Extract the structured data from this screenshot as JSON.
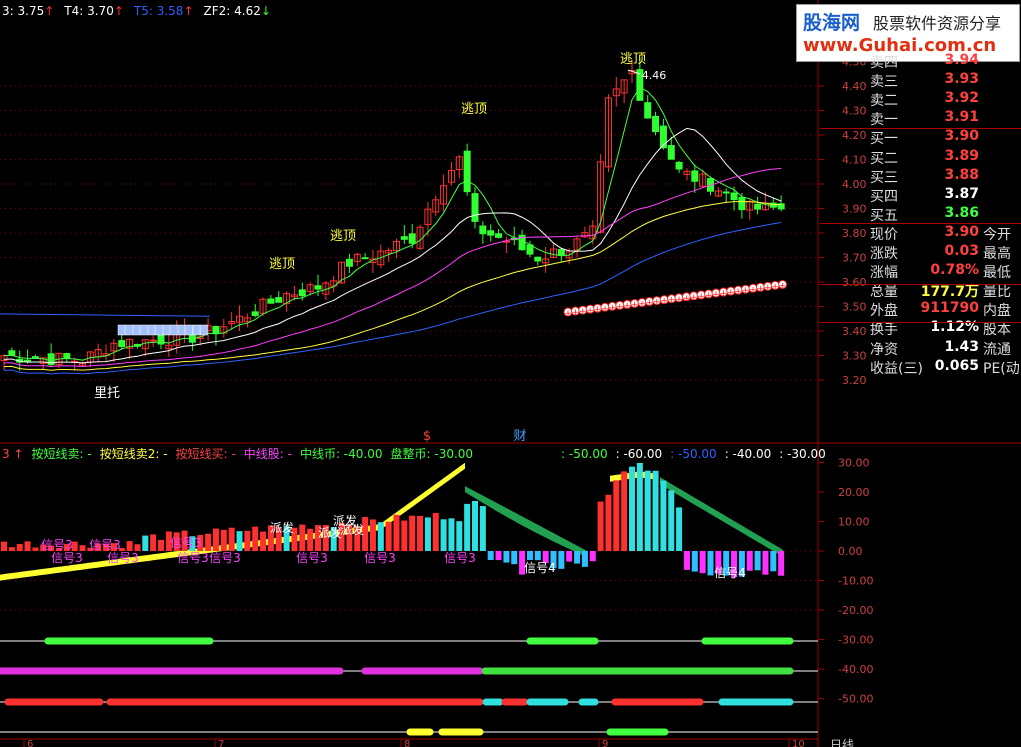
{
  "top_indicators": [
    {
      "text": "3: 3.75",
      "arrow": "↑",
      "color": "#ffffff",
      "arrow_color": "#ff3030"
    },
    {
      "text": "T4: 3.70",
      "arrow": "↑",
      "color": "#ffffff",
      "arrow_color": "#ff3030"
    },
    {
      "text": "T5: 3.58",
      "arrow": "↑",
      "color": "#3060ff",
      "arrow_color": "#ff3030"
    },
    {
      "text": "ZF2: 4.62",
      "arrow": "↓",
      "color": "#ffffff",
      "arrow_color": "#30ff30"
    }
  ],
  "logo": {
    "brand": "股海网",
    "slogan": "股票软件资源分享",
    "url": "www.Guhai.com.cn"
  },
  "quote_rows": [
    {
      "label": "卖四",
      "value": "3.94",
      "color": "#ff4040",
      "right": ""
    },
    {
      "label": "卖三",
      "value": "3.93",
      "color": "#ff4040",
      "right": ""
    },
    {
      "label": "卖二",
      "value": "3.92",
      "color": "#ff4040",
      "right": ""
    },
    {
      "label": "卖一",
      "value": "3.91",
      "color": "#ff4040",
      "right": ""
    },
    {
      "label": "买一",
      "value": "3.90",
      "color": "#ff4040",
      "right": ""
    },
    {
      "label": "买二",
      "value": "3.89",
      "color": "#ff4040",
      "right": ""
    },
    {
      "label": "买三",
      "value": "3.88",
      "color": "#ff4040",
      "right": ""
    },
    {
      "label": "买四",
      "value": "3.87",
      "color": "#ffffff",
      "right": ""
    },
    {
      "label": "买五",
      "value": "3.86",
      "color": "#40ff40",
      "right": ""
    },
    {
      "label": "现价",
      "value": "3.90",
      "color": "#ff4040",
      "right": "今开"
    },
    {
      "label": "涨跌",
      "value": "0.03",
      "color": "#ff4040",
      "right": "最高"
    },
    {
      "label": "涨幅",
      "value": "0.78%",
      "color": "#ff4040",
      "right": "最低"
    },
    {
      "label": "总量",
      "value": "177.7万",
      "color": "#ffff40",
      "right": "量比"
    },
    {
      "label": "外盘",
      "value": "911790",
      "color": "#ff4040",
      "right": "内盘"
    },
    {
      "label": "换手",
      "value": "1.12%",
      "color": "#ffffff",
      "right": "股本"
    },
    {
      "label": "净资",
      "value": "1.43",
      "color": "#ffffff",
      "right": "流通"
    },
    {
      "label": "收益(三)",
      "value": "0.065",
      "color": "#ffffff",
      "right": "PE(动"
    }
  ],
  "indicator_legend": [
    {
      "text": "3 ↑",
      "color": "#ff4040"
    },
    {
      "text": "按短线卖: -",
      "color": "#40ff40"
    },
    {
      "text": "按短线卖2: -",
      "color": "#ffff40"
    },
    {
      "text": "按短线买: -",
      "color": "#ff4040"
    },
    {
      "text": "中线股: -",
      "color": "#ff40ff"
    },
    {
      "text": "中线币: -40.00",
      "color": "#40ff40"
    },
    {
      "text": "盘整币: -30.00",
      "color": "#40ff40"
    },
    {
      "text": ": -50.00",
      "color": "#40ff40"
    },
    {
      "text": ": -60.00",
      "color": "#ffffff"
    },
    {
      "text": ": -50.00",
      "color": "#3060ff"
    },
    {
      "text": ": -40.00",
      "color": "#ffffff"
    },
    {
      "text": ": -30.00",
      "color": "#ffffff"
    }
  ],
  "chart_data": [
    {
      "type": "candlestick",
      "title": "",
      "ylim": [
        3.12,
        4.55
      ],
      "yticks": [
        "4.40",
        "4.30",
        "4.20",
        "4.10",
        "4.00",
        "3.90",
        "3.80",
        "3.70",
        "3.60",
        "3.50",
        "3.40",
        "3.30",
        "3.20"
      ],
      "y_axis_top_partial": "4.50",
      "key_values": {
        "low_start": 3.25,
        "peak": 4.46,
        "last_close": 3.9
      },
      "annotations": [
        {
          "text": "里托",
          "color": "#ffffff"
        },
        {
          "text": "逃顶",
          "color": "#ffff40"
        },
        {
          "text": "逃顶",
          "color": "#ffff40"
        },
        {
          "text": "逃顶",
          "color": "#ffff40"
        },
        {
          "text": "逃顶",
          "color": "#ffff40"
        },
        {
          "text": "4.46",
          "color": "#ffffff"
        },
        {
          "text": "$",
          "color": "#ff4040"
        },
        {
          "text": "财",
          "color": "#40a0ff"
        }
      ],
      "moving_average_colors": [
        "#40ff40",
        "#ffffff",
        "#ff40ff",
        "#ffff40",
        "#3060ff"
      ]
    },
    {
      "type": "bar",
      "title": "",
      "ylim": [
        -30,
        35
      ],
      "yticks": [
        "30.00",
        "20.00",
        "10.00",
        "0.00",
        "-10.00",
        "-20.00",
        "-30.00",
        "-40.00",
        "-50.00"
      ],
      "signal_labels": [
        {
          "text": "信号3",
          "color": "#ff40ff"
        },
        {
          "text": "信号3",
          "color": "#ff40ff"
        },
        {
          "text": "信号3",
          "color": "#ff40ff"
        },
        {
          "text": "信号3",
          "color": "#ff40ff"
        },
        {
          "text": "信号3",
          "color": "#ff40ff"
        },
        {
          "text": "信号3",
          "color": "#ff40ff"
        },
        {
          "text": "信号3",
          "color": "#ff40ff"
        },
        {
          "text": "信号3",
          "color": "#ff40ff"
        },
        {
          "text": "信号3",
          "color": "#ff40ff"
        },
        {
          "text": "信号3",
          "color": "#ff40ff"
        },
        {
          "text": "信号4",
          "color": "#ffffff"
        },
        {
          "text": "信号4",
          "color": "#ffffff"
        },
        {
          "text": "派发",
          "color": "#ffffff"
        },
        {
          "text": "派发",
          "color": "#ffffff"
        },
        {
          "text": "派发",
          "color": "#ffffff"
        },
        {
          "text": "派发",
          "color": "#ffffff"
        }
      ]
    }
  ],
  "x_axis_labels": [
    "6",
    "7",
    "8",
    "9",
    "10"
  ],
  "bottom_tab": "日线"
}
